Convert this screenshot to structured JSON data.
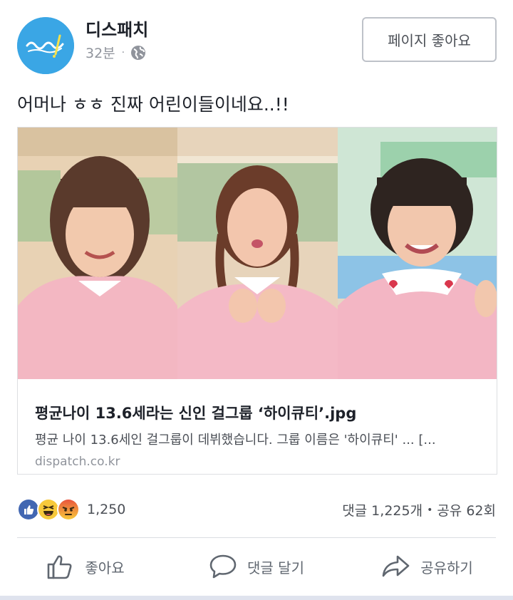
{
  "post": {
    "page_name": "디스패치",
    "time": "32분",
    "dot": "·",
    "like_page_label": "페이지 좋아요",
    "text": "어머나 ㅎㅎ 진짜 어린이들이네요..!!"
  },
  "link": {
    "title": "평균나이 13.6세라는 신인 걸그룹 ‘하이큐티’.jpg",
    "description": "평균 나이 13.6세인 걸그룹이 데뷔했습니다. 그룹 이름은 '하이큐티' ... [...",
    "domain": "dispatch.co.kr"
  },
  "reactions": {
    "icons": [
      "like-icon",
      "haha-icon",
      "angry-icon"
    ],
    "count": "1,250"
  },
  "stats": {
    "comments": "댓글 1,225개",
    "sep": "•",
    "shares": "공유 62회"
  },
  "actions": {
    "like": "좋아요",
    "comment": "댓글 달기",
    "share": "공유하기"
  },
  "colors": {
    "avatar": "#3aa6e5",
    "like_blue": "#4267b2",
    "text": "#1d2129",
    "muted": "#90949c"
  }
}
